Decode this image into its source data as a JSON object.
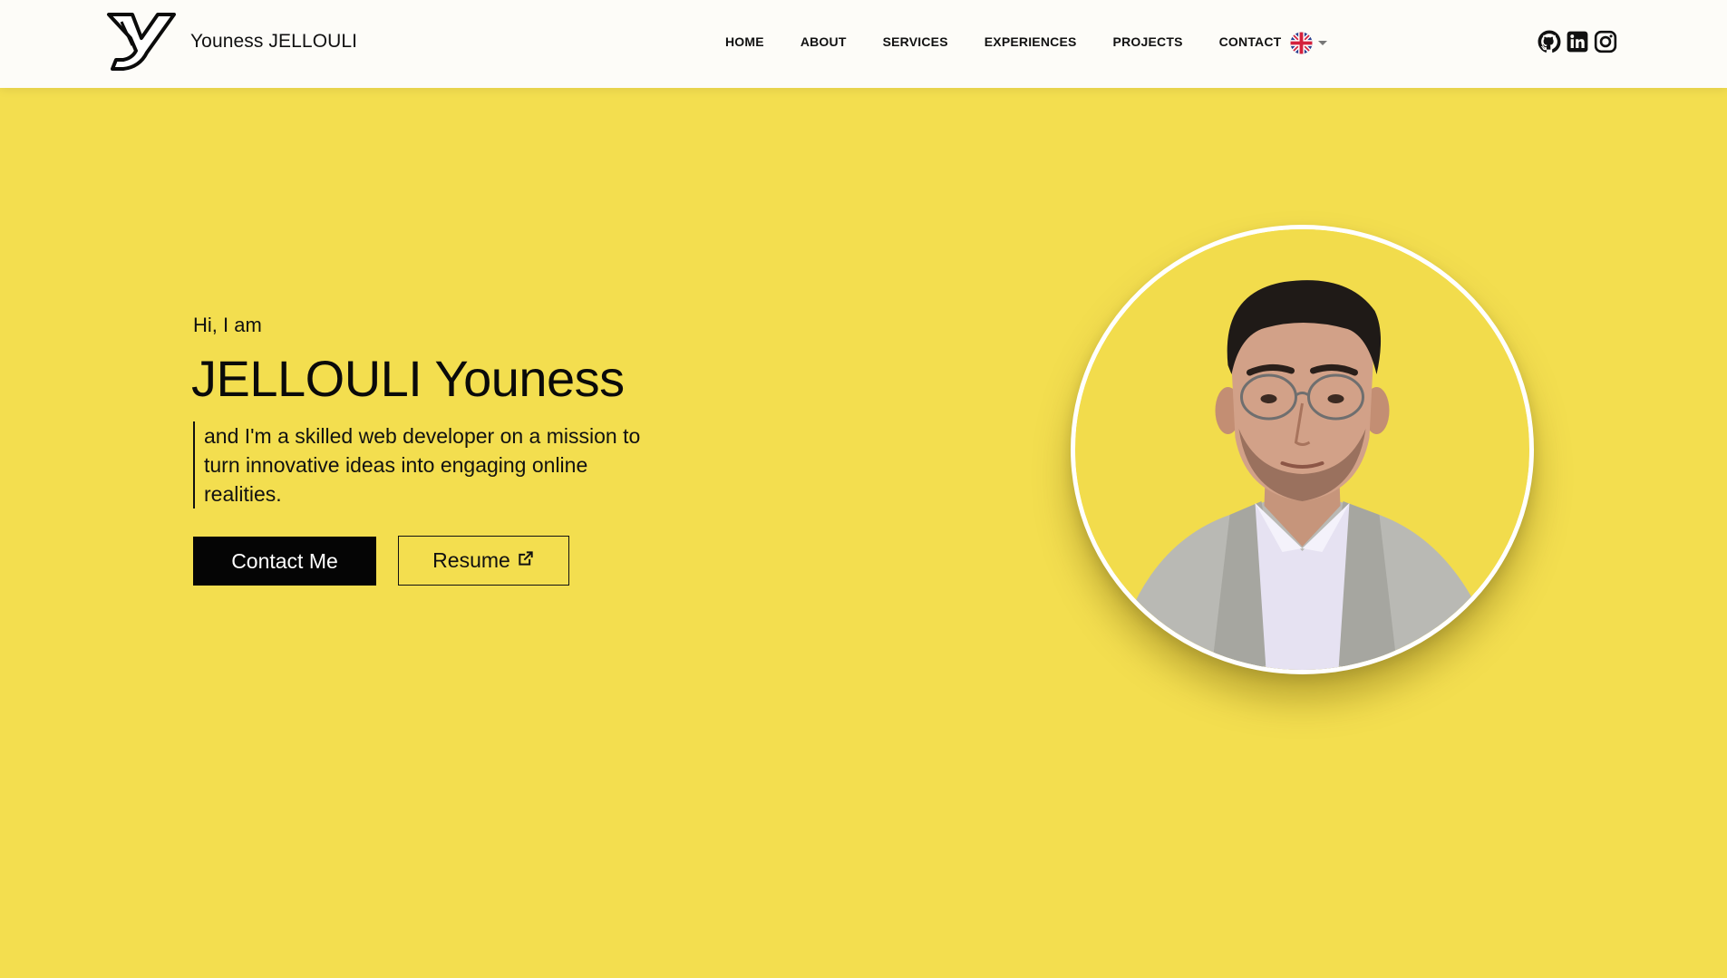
{
  "brand": {
    "name": "Youness JELLOULI",
    "logo": "yj-monogram-logo"
  },
  "nav": {
    "links": [
      "HOME",
      "ABOUT",
      "SERVICES",
      "EXPERIENCES",
      "PROJECTS",
      "CONTACT"
    ],
    "language_icon": "uk-flag-icon"
  },
  "social": [
    "github-icon",
    "linkedin-icon",
    "instagram-icon"
  ],
  "hero": {
    "greeting": "Hi, I am",
    "name": "JELLOULI Youness",
    "tagline": "and I'm a skilled web developer on a mission to turn innovative ideas into engaging online realities.",
    "contact_button": "Contact Me",
    "resume_button": "Resume",
    "resume_icon": "external-link-icon"
  },
  "colors": {
    "background": "#f3de4f",
    "navbar": "#fdfcf8",
    "accent": "#050505",
    "ring": "#ffffff"
  }
}
